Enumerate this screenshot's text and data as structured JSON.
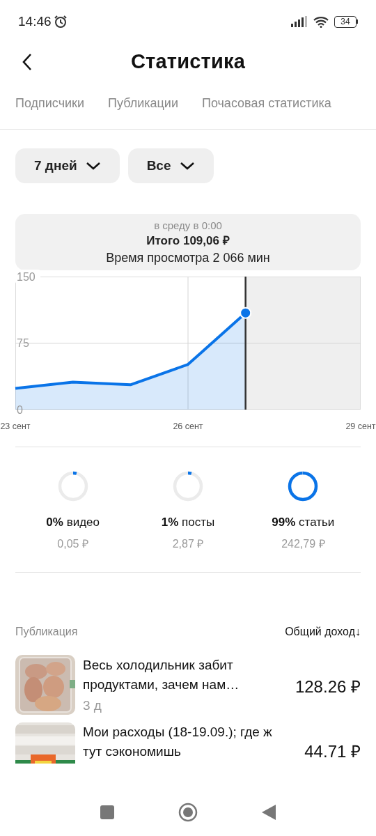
{
  "status_bar": {
    "time": "14:46",
    "battery": "34"
  },
  "header": {
    "title": "Статистика"
  },
  "tabs": [
    {
      "label": "Подписчики",
      "selected": false
    },
    {
      "label": "Публикации",
      "selected": false
    },
    {
      "label": "Почасовая статистика",
      "selected": false
    }
  ],
  "filters": [
    {
      "label": "7 дней"
    },
    {
      "label": "Все"
    }
  ],
  "tooltip": {
    "when": "в среду в 0:00",
    "total": "Итого 109,06 ₽",
    "watch_time": "Время просмотра 2 066 мин"
  },
  "chart_data": {
    "type": "area",
    "x": [
      23,
      24,
      25,
      26,
      27
    ],
    "series": [
      {
        "color": "#0a74e8",
        "values": [
          24,
          31,
          28,
          51,
          109
        ]
      }
    ],
    "xlim": [
      23,
      29
    ],
    "ylim": [
      0,
      150
    ],
    "xticks": [
      {
        "value": 23,
        "label": "23 сент"
      },
      {
        "value": 26,
        "label": "26 сент"
      },
      {
        "value": 29,
        "label": "29 сент"
      }
    ],
    "yticks": [
      0,
      75,
      150
    ],
    "ref_lines": [
      {
        "axis": "x",
        "value": 27
      }
    ],
    "bands": [
      {
        "axis": "x",
        "from": 27,
        "to": 29
      }
    ]
  },
  "breakdown": [
    {
      "percent": "0%",
      "label": "видео",
      "amount": "0,05 ₽",
      "level": 0
    },
    {
      "percent": "1%",
      "label": "посты",
      "amount": "2,87 ₽",
      "level": 0.01
    },
    {
      "percent": "99%",
      "label": "статьи",
      "amount": "242,79 ₽",
      "level": 0.99
    }
  ],
  "list_header": {
    "column_1": "Публикация",
    "column_2": "Общий доход↓"
  },
  "publications": [
    {
      "title": "Весь холодильник забит продуктами, зачем нам…",
      "age": "3 д",
      "income": "128.26 ₽",
      "kind": "picture"
    },
    {
      "title": "Мои расходы (18-19.09.); где ж тут сэкономишь",
      "income": "44.71 ₽",
      "kind": "picture"
    }
  ]
}
